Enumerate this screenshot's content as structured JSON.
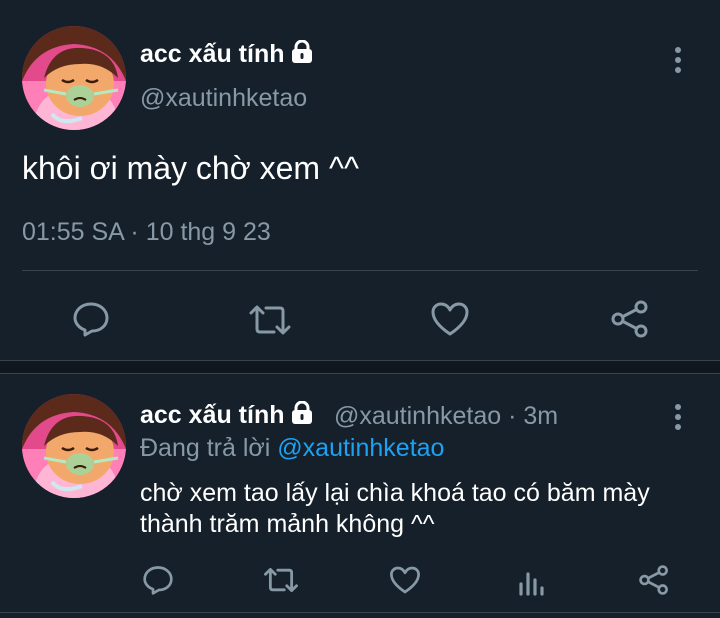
{
  "main_tweet": {
    "display_name": "acc xấu tính",
    "handle": "@xautinhketao",
    "text": "khôi ơi mày chờ xem ^^",
    "timestamp": "01:55 SA · 10 thg 9 23",
    "avatar_icon": "cartoon-girl-avatar",
    "lock_icon": "lock-icon",
    "actions": [
      "reply-icon",
      "retweet-icon",
      "like-icon",
      "share-icon"
    ]
  },
  "reply_tweet": {
    "display_name": "acc xấu tính",
    "handle_time": "@xautinhketao · 3m",
    "replying_label": "Đang trả lời",
    "replying_to": "@xautinhketao",
    "text": "chờ xem tao lấy lại chìa khoá tao có băm mày thành trăm mảnh không ^^",
    "avatar_icon": "cartoon-girl-avatar",
    "lock_icon": "lock-icon",
    "actions": [
      "reply-icon",
      "retweet-icon",
      "like-icon",
      "analytics-icon",
      "share-icon"
    ]
  },
  "colors": {
    "background": "#15202b",
    "text_primary": "#ffffff",
    "text_secondary": "#8899a6",
    "accent": "#1da1f2",
    "divider": "#38444d"
  }
}
